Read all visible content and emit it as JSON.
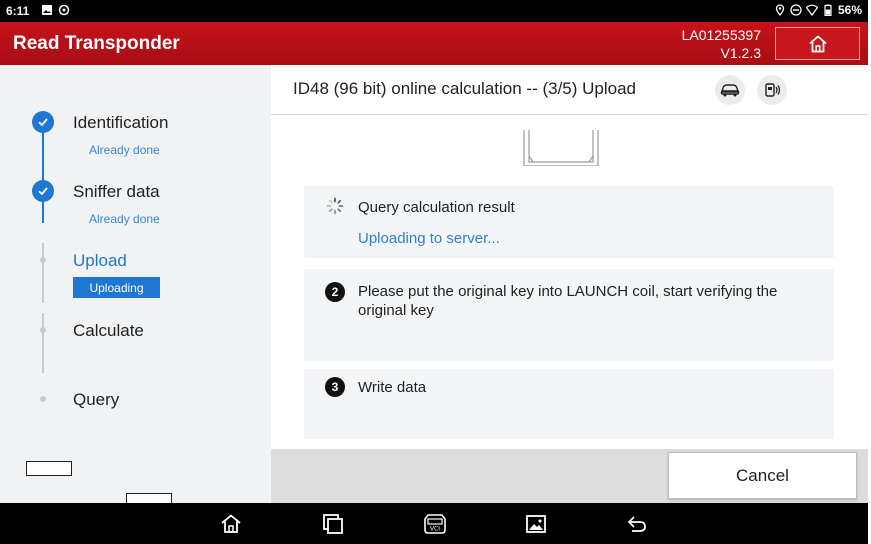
{
  "status_bar": {
    "time": "6:11",
    "battery": "56%"
  },
  "header": {
    "title": "Read Transponder",
    "serial": "LA01255397",
    "version": "V1.2.3"
  },
  "steps": [
    {
      "label": "Identification",
      "sub": "Already done",
      "state": "done"
    },
    {
      "label": "Sniffer data",
      "sub": "Already done",
      "state": "done"
    },
    {
      "label": "Upload",
      "sub": "Uploading",
      "state": "active"
    },
    {
      "label": "Calculate",
      "sub": "",
      "state": "pending"
    },
    {
      "label": "Query",
      "sub": "",
      "state": "pending"
    }
  ],
  "main": {
    "title": "ID48 (96 bit) online calculation -- (3/5) Upload",
    "cards": [
      {
        "text": "Query calculation result",
        "status": "Uploading to server...",
        "marker": "spinner"
      },
      {
        "number": "2",
        "text": "Please put the original key into LAUNCH coil, start verifying the original key"
      },
      {
        "number": "3",
        "text": "Write data"
      }
    ]
  },
  "footer": {
    "cancel_label": "Cancel"
  },
  "colors": {
    "header_red": "#c8121b",
    "accent_blue": "#1f77d4"
  },
  "icons": {
    "status_bar": [
      "photo-icon",
      "settings-icon",
      "location-icon",
      "do-not-disturb-icon",
      "wifi-icon",
      "battery-icon"
    ],
    "header": [
      "home-icon"
    ],
    "main_header": [
      "car-icon",
      "key-icon"
    ],
    "nav_bar": [
      "home-icon",
      "recent-apps-icon",
      "vci-icon",
      "gallery-icon",
      "back-icon"
    ]
  }
}
